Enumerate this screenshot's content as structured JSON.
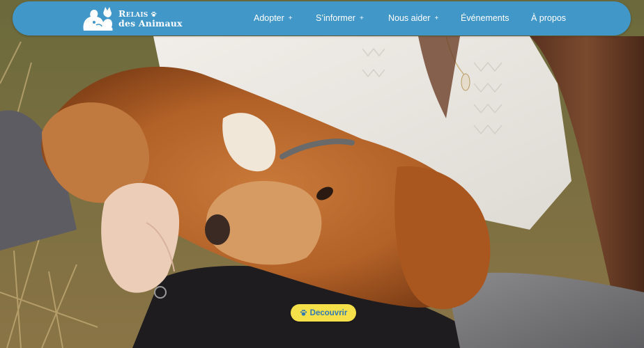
{
  "brand": {
    "line1": "Relais",
    "line2": "des Animaux"
  },
  "nav": {
    "items": [
      {
        "label": "Adopter",
        "plus": "+"
      },
      {
        "label": "S’informer",
        "plus": "+"
      },
      {
        "label": "Nous aider",
        "plus": "+"
      },
      {
        "label": "Événements",
        "plus": ""
      },
      {
        "label": "À propos",
        "plus": ""
      }
    ]
  },
  "hero": {
    "cta_label": "Decouvrir"
  },
  "icons": {
    "logo": "person-with-dog-and-cat-logo",
    "brand_paw": "paw-icon",
    "cta_paw": "paw-icon"
  },
  "colors": {
    "nav_background": "#4297c9",
    "cta_background": "#f5e04a",
    "cta_text": "#2f78b4"
  }
}
